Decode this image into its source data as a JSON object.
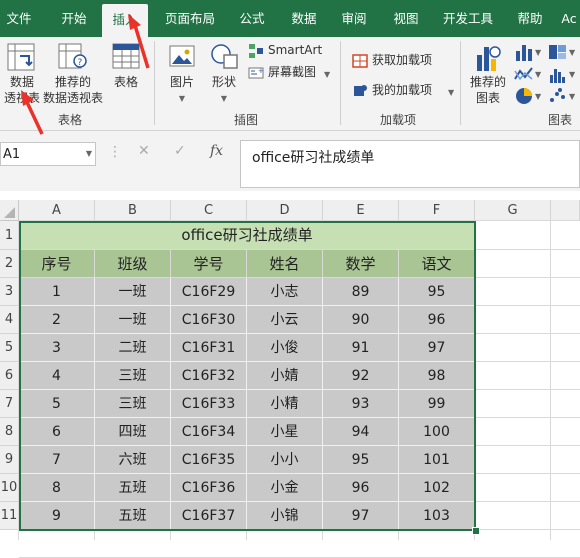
{
  "tabs": [
    "文件",
    "开始",
    "插入",
    "页面布局",
    "公式",
    "数据",
    "审阅",
    "视图",
    "开发工具",
    "帮助",
    "Ac"
  ],
  "active_tab": "插入",
  "ribbon": {
    "pivot_label_line1": "数据",
    "pivot_label_line2": "透视表",
    "rec_pivot_line1": "推荐的",
    "rec_pivot_line2": "数据透视表",
    "table_label": "表格",
    "group_tables": "表格",
    "pictures_label": "图片",
    "shapes_label": "形状",
    "smartart_label": "SmartArt",
    "screenshot_label": "屏幕截图",
    "group_illustrations": "插图",
    "get_addins_label": "获取加载项",
    "my_addins_label": "我的加载项",
    "group_addins": "加载项",
    "rec_charts_line1": "推荐的",
    "rec_charts_line2": "图表",
    "group_charts": "图表"
  },
  "formula_bar": {
    "name_box": "A1",
    "fx_symbol": "fx",
    "formula": "office研习社成绩单"
  },
  "columns": [
    "A",
    "B",
    "C",
    "D",
    "E",
    "F",
    "G"
  ],
  "rows": [
    "1",
    "2",
    "3",
    "4",
    "5",
    "6",
    "7",
    "8",
    "9",
    "10",
    "11"
  ],
  "sheet": {
    "title": "office研习社成绩单",
    "headers": [
      "序号",
      "班级",
      "学号",
      "姓名",
      "数学",
      "语文"
    ],
    "records": [
      [
        "1",
        "一班",
        "C16F29",
        "小志",
        "89",
        "95"
      ],
      [
        "2",
        "一班",
        "C16F30",
        "小云",
        "90",
        "96"
      ],
      [
        "3",
        "二班",
        "C16F31",
        "小俊",
        "91",
        "97"
      ],
      [
        "4",
        "三班",
        "C16F32",
        "小婧",
        "92",
        "98"
      ],
      [
        "5",
        "三班",
        "C16F33",
        "小精",
        "93",
        "99"
      ],
      [
        "6",
        "四班",
        "C16F34",
        "小星",
        "94",
        "100"
      ],
      [
        "7",
        "六班",
        "C16F35",
        "小小",
        "95",
        "101"
      ],
      [
        "8",
        "五班",
        "C16F36",
        "小金",
        "96",
        "102"
      ],
      [
        "9",
        "五班",
        "C16F37",
        "小锦",
        "97",
        "103"
      ]
    ]
  },
  "colors": {
    "brand": "#217346",
    "title_fill": "#c6e0b4",
    "header_fill": "#a9c594",
    "body_fill": "#c9c9c9",
    "annotation": "#e8322a"
  }
}
